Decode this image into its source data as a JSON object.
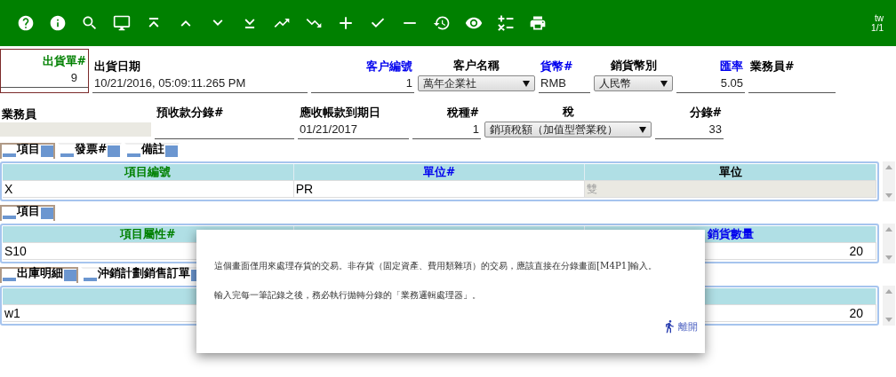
{
  "toolbar": {
    "language": "tw",
    "page": "1/1"
  },
  "header_row_1": [
    {
      "label": "出貨單#",
      "required": true,
      "lookup": false,
      "kind": "boxed",
      "value": "9"
    },
    {
      "label": "出貨日期",
      "required": false,
      "lookup": false,
      "kind": "text",
      "value": "10/21/2016, 05:09:11.265 PM"
    },
    {
      "label": "客户編號",
      "required": false,
      "lookup": true,
      "kind": "number",
      "value": "1"
    },
    {
      "label": "客户名稱",
      "required": false,
      "lookup": false,
      "kind": "select",
      "value": "萬年企業社"
    },
    {
      "label": "貨幣#",
      "required": false,
      "lookup": true,
      "kind": "text",
      "value": "RMB"
    },
    {
      "label": "銷貨幣別",
      "required": false,
      "lookup": false,
      "kind": "select",
      "value": "人民幣"
    },
    {
      "label": "匯率",
      "required": false,
      "lookup": true,
      "kind": "number",
      "value": "5.05"
    },
    {
      "label": "業務員#",
      "required": false,
      "lookup": false,
      "kind": "text"
    }
  ],
  "header_row_2": [
    {
      "label": "業務員",
      "required": false,
      "lookup": false,
      "kind": "gray"
    },
    {
      "label": "預收款分錄#",
      "required": false,
      "lookup": false,
      "kind": "text"
    },
    {
      "label": "應收帳款到期日",
      "required": false,
      "lookup": false,
      "kind": "text",
      "value": "01/21/2017"
    },
    {
      "label": "稅種#",
      "required": false,
      "lookup": false,
      "kind": "number",
      "value": "1"
    },
    {
      "label": "稅",
      "required": false,
      "lookup": false,
      "kind": "select",
      "value": "銷項稅額（加值型營業稅）"
    },
    {
      "label": "分錄#",
      "required": false,
      "lookup": false,
      "kind": "number",
      "value": "33"
    }
  ],
  "sections": [
    {
      "tabs": [
        {
          "label": "項目",
          "selected": true
        },
        {
          "label": "發票#",
          "selected": false
        },
        {
          "label": "備註",
          "selected": false
        }
      ],
      "columns": [
        {
          "label": "項目編號",
          "required": true,
          "lookup": false
        },
        {
          "label": "單位#",
          "required": false,
          "lookup": true
        },
        {
          "label": "單位",
          "required": false,
          "lookup": false
        }
      ],
      "rows": [
        [
          {
            "value": "X",
            "kind": "text"
          },
          {
            "value": "PR",
            "kind": "text"
          },
          {
            "value": "雙",
            "kind": "readonly"
          }
        ]
      ]
    },
    {
      "tabs": [
        {
          "label": "項目",
          "selected": true
        }
      ],
      "columns": [
        {
          "label": "項目屬性#",
          "required": true,
          "lookup": false
        },
        {},
        {
          "label": "銷貨數量",
          "required": false,
          "lookup": true
        }
      ],
      "rows": [
        [
          {
            "value": "S10",
            "kind": "text"
          },
          {},
          {
            "value": "20",
            "kind": "number"
          }
        ]
      ]
    },
    {
      "tabs": [
        {
          "label": "出庫明細",
          "selected": true
        },
        {
          "label": "沖銷計劃銷售訂單",
          "selected": false
        }
      ],
      "columns": [
        {},
        {},
        {}
      ],
      "rows": [
        [
          {
            "value": "w1",
            "kind": "text"
          },
          {},
          {
            "value": "20",
            "kind": "number"
          }
        ]
      ]
    }
  ],
  "dialog": {
    "messages": [
      "這個畫面僅用來處理存貨的交易。非存貨（固定資產、費用類雜項）的交易，應該直接在分錄畫面[M4P1]輸入。",
      "輸入完每一筆記錄之後，務必執行拋轉分錄的「業務邏輯處理器」。"
    ],
    "close_label": "離開"
  }
}
